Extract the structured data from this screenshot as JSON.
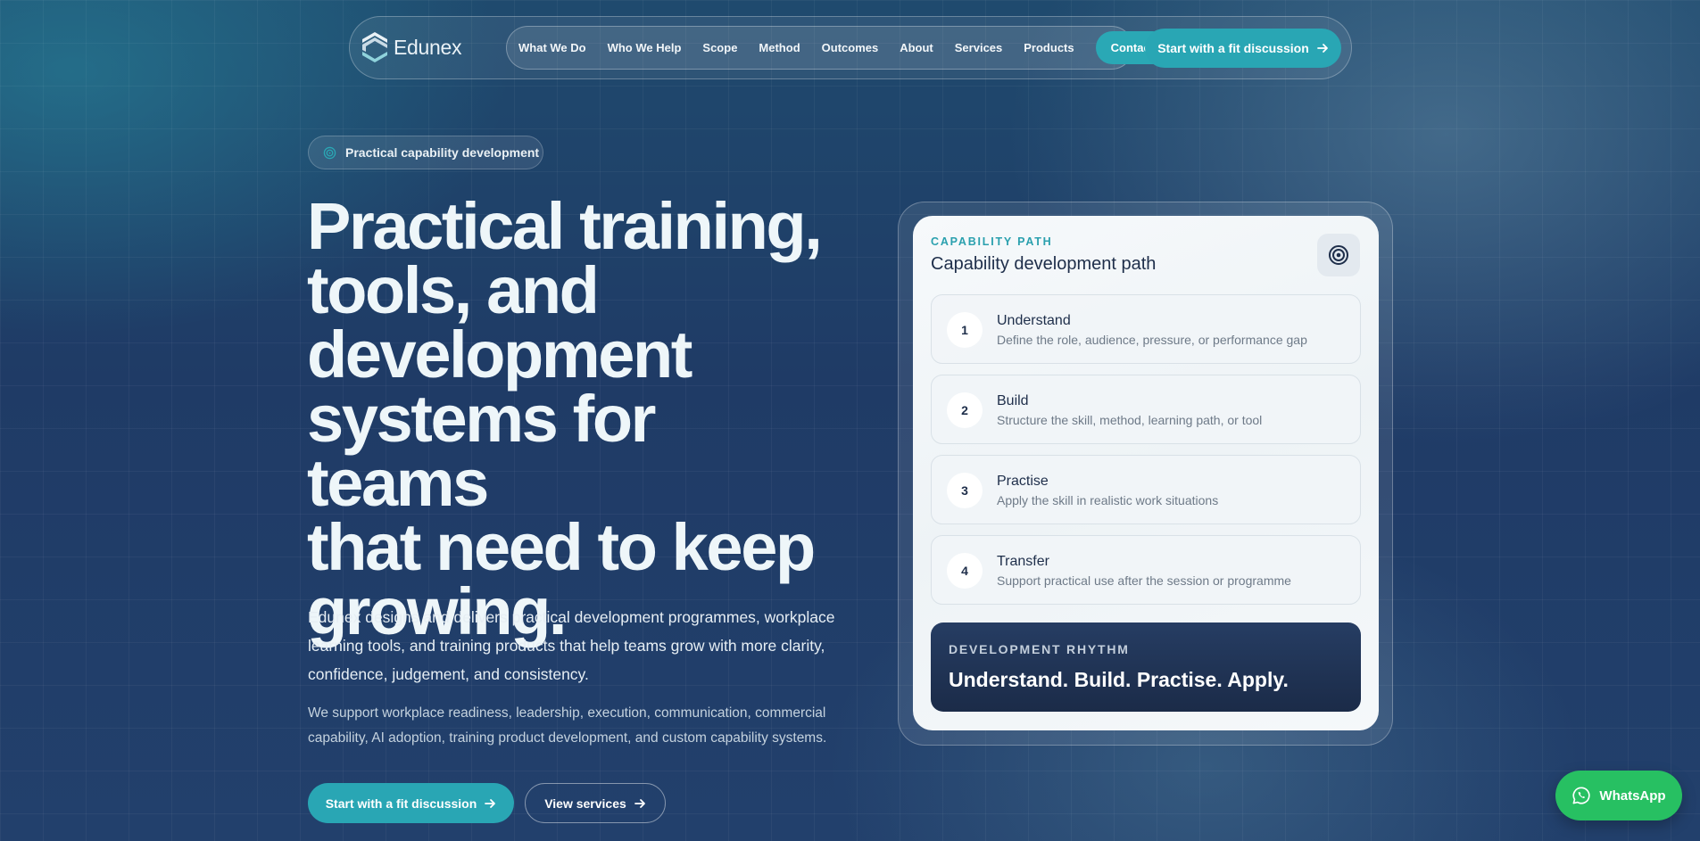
{
  "brand": {
    "name": "Edunex"
  },
  "nav": {
    "links": [
      "What We Do",
      "Who We Help",
      "Scope",
      "Method",
      "Outcomes",
      "About",
      "Services",
      "Products"
    ],
    "contact_label": "Contact",
    "cta_label": "Start with a fit discussion"
  },
  "hero": {
    "pill": "Practical capability development",
    "title_lines": [
      "Practical training,",
      "tools, and",
      "development",
      "systems for teams",
      "that need to keep",
      "growing."
    ],
    "lead": "Edunex designs and delivers practical development programmes, workplace learning tools, and training products that help teams grow with more clarity, confidence, judgement, and consistency.",
    "sub": "We support workplace readiness, leadership, execution, communication, commercial capability, AI adoption, training product development, and custom capability systems.",
    "primary_cta": "Start with a fit discussion",
    "secondary_cta": "View services"
  },
  "card": {
    "eyebrow": "CAPABILITY PATH",
    "title": "Capability development path",
    "icon": "target-icon",
    "steps": [
      {
        "num": "1",
        "title": "Understand",
        "desc": "Define the role, audience, pressure, or performance gap"
      },
      {
        "num": "2",
        "title": "Build",
        "desc": "Structure the skill, method, learning path, or tool"
      },
      {
        "num": "3",
        "title": "Practise",
        "desc": "Apply the skill in realistic work situations"
      },
      {
        "num": "4",
        "title": "Transfer",
        "desc": "Support practical use after the session or programme"
      }
    ],
    "rhythm_eyebrow": "DEVELOPMENT RHYTHM",
    "rhythm_text": "Understand. Build. Practise. Apply."
  },
  "whatsapp": {
    "label": "WhatsApp",
    "icon": "whatsapp-icon"
  },
  "colors": {
    "accent": "#29a6b4",
    "navy": "#1e2e4a",
    "whatsapp": "#27c062"
  }
}
